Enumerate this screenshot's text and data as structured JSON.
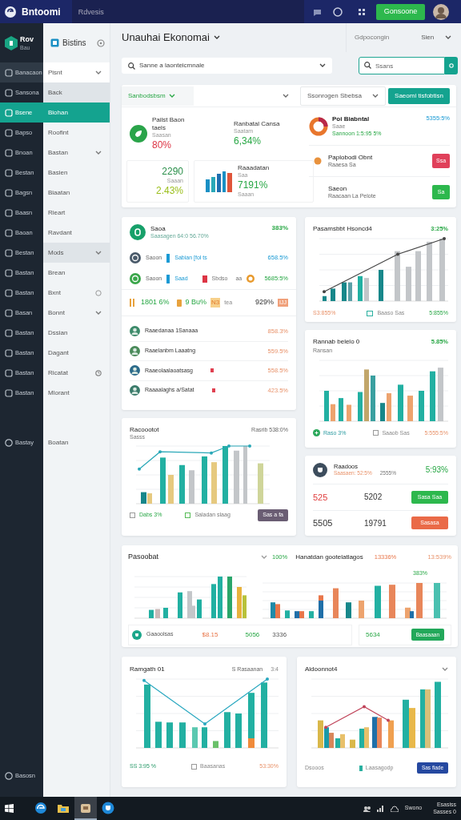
{
  "top_bar": {
    "logo": "Bntoomi",
    "search": "Rdvesis",
    "button": "Gonsoone"
  },
  "rail": {
    "title": "Rov",
    "subtitle": "Bau",
    "items": [
      {
        "label": "Banacaon",
        "selected": false
      },
      {
        "label": "Sansona",
        "selected": false
      },
      {
        "label": "Bsene",
        "selected": true
      },
      {
        "label": "Bapso",
        "selected": false
      },
      {
        "label": "Bnoan",
        "selected": false
      },
      {
        "label": "Bestan",
        "selected": false
      },
      {
        "label": "Bagsn",
        "selected": false
      },
      {
        "label": "Baasn",
        "selected": false
      },
      {
        "label": "Baoan",
        "selected": false
      },
      {
        "label": "Bestan",
        "selected": false
      },
      {
        "label": "Bastan",
        "selected": false
      },
      {
        "label": "Bastan",
        "selected": false
      },
      {
        "label": "Basan",
        "selected": false
      },
      {
        "label": "Bastan",
        "selected": false
      },
      {
        "label": "Bastan",
        "selected": false
      },
      {
        "label": "Bastan",
        "selected": false
      },
      {
        "label": "Bastan",
        "selected": false
      }
    ],
    "lower_item": "Bastay",
    "footer": "Basosn"
  },
  "panel": {
    "title": "Bistins",
    "items": [
      {
        "label": "Pisnt",
        "selected": false,
        "kind": "raised",
        "expandable": true
      },
      {
        "label": "Back",
        "selected": false,
        "kind": "shaded"
      },
      {
        "label": "Biohan",
        "selected": true
      },
      {
        "label": "Roofint",
        "selected": false
      },
      {
        "label": "Bastan",
        "selected": false,
        "expandable": true
      },
      {
        "label": "Basien",
        "selected": false
      },
      {
        "label": "Biaatan",
        "selected": false
      },
      {
        "label": "Rieart",
        "selected": false
      },
      {
        "label": "Ravdant",
        "selected": false
      },
      {
        "label": "Mods",
        "selected": false,
        "kind": "shaded",
        "expandable": true
      },
      {
        "label": "Brean",
        "selected": false
      },
      {
        "label": "Bxnt",
        "selected": false,
        "info": true
      },
      {
        "label": "Bonnt",
        "selected": false,
        "expandable": true
      },
      {
        "label": "Dssian",
        "selected": false
      },
      {
        "label": "Dagant",
        "selected": false
      },
      {
        "label": "Ricatat",
        "selected": false,
        "timer": true
      },
      {
        "label": "Mlorant",
        "selected": false
      }
    ],
    "lower_item": "Boatan"
  },
  "header": {
    "title": "Unauhai Ekonomai",
    "right_link": "Gdpocongin",
    "right_select": "Sien"
  },
  "filter": {
    "value": "Sanne a laonteicmnale",
    "search_placeholder": "Ssans"
  },
  "overview": {
    "dropdowns": [
      {
        "kind": "accent",
        "label": "Sanbodsbsm"
      },
      {
        "kind": "blank"
      },
      {
        "kind": "outlined",
        "label": "Ssonrogen Sbebsa"
      }
    ],
    "action": "Saeomi tisfobtisn",
    "stats": [
      {
        "title": "Pailst Baon taels",
        "sub": "Saasan",
        "value": "80%",
        "color": "#dc3545"
      },
      {
        "title": "Ranbatal Cansa",
        "sub": "Saatam",
        "value": "6,34%",
        "color": "#28a745"
      },
      {
        "title": "2290",
        "sub": "Saaan",
        "value": "2.43%",
        "color": "#9bbf1c"
      },
      {
        "title": "Raaadatan",
        "sub": "Saa",
        "value": "7191%",
        "color": "#28a745",
        "sub2": "Saaan"
      }
    ],
    "summary": {
      "title": "Poi Biabntal",
      "sub": "Saae",
      "line": "Sannoon 1:5:95 5%",
      "value": "5355:5%"
    },
    "actions": [
      {
        "title": "Paplobodi Obnt",
        "sub": "Raaesa Sa",
        "button": "Ssa",
        "color": "#e0405a"
      },
      {
        "title": "Saeon",
        "sub": "Raacaan La Pelote",
        "button": "Sa",
        "color": "#2db84d"
      }
    ]
  },
  "list_card": {
    "title": "Saoa",
    "sub": "Saasagen 64:0 56.70%",
    "value": "383%",
    "rows": [
      {
        "name": "Saoon",
        "tag": "Sabian [fol ts",
        "value": "658.5%"
      },
      {
        "name": "Saoon",
        "tag": "Saad",
        "tag2": "Sbdso",
        "tag3": "aa",
        "value": "5685:5%"
      }
    ],
    "stats": [
      "1801 6%",
      "9 Bu%",
      "N3",
      "tea",
      "929%",
      "IJJ"
    ],
    "items": [
      {
        "name": "Raaedanaa 1Sanaaa",
        "value": "858.3%",
        "flag": false
      },
      {
        "name": "Raaelanbm Laaatng",
        "value": "559.5%",
        "flag": false
      },
      {
        "name": "Raaeolaalaoatsasg",
        "value": "558.5%",
        "flag": true
      },
      {
        "name": "Raaaalaghs a/Satat",
        "value": "423.5%",
        "flag": true
      }
    ]
  },
  "trend_card": {
    "title": "Pasamsbbt Hsoncd4",
    "value": "3:25%",
    "footer_left": "S3:855%",
    "legend": "Baaso Sas",
    "footer_right": "5:855%"
  },
  "bars_card": {
    "title": "Rannab belelo 0",
    "value": "5.85%",
    "sub": "Ransan",
    "legend1": "Raso 3%",
    "legend2": "Saaob Sas",
    "footer_right": "5:555:5%"
  },
  "combo_card": {
    "title": "Racoootot",
    "sub": "Sasss",
    "right": "Rasrib 538:0%",
    "legend1": "Dabs 3%",
    "legend2": "Saladan slaag",
    "button": "Sas a fa"
  },
  "money_card": {
    "title": "Raadoos",
    "sub": "Saasaen: 52:5%",
    "sub2": "2555%",
    "value": "5:93%",
    "rows": [
      {
        "a": "525",
        "b": "5202",
        "button": "Sasa Saa",
        "kind": "good"
      },
      {
        "a": "5505",
        "b": "19791",
        "button": "Sasasa",
        "kind": "bad"
      }
    ]
  },
  "wide_card": {
    "title": "Pasoobat",
    "value1": "100%",
    "title2": "Hanatdan gootelatlagos",
    "value2": "13336%",
    "value3": "13:539%",
    "peak": "383%",
    "footer": [
      "Gaaoolsas",
      "$8.15",
      "5056",
      "3336",
      "5634"
    ],
    "button": "Baasaaan"
  },
  "report_card": {
    "title": "Ramgath 01",
    "link": "S Rasaanan",
    "more": "3:4",
    "footer_left": "SS 3:95 %",
    "legend": "Baasanas",
    "footer_right": "53:30%"
  },
  "last_card": {
    "title": "Aldoonnot4",
    "footer_left": "Dsooos",
    "legend": "Laasagodp",
    "button": "Sas fiade"
  },
  "taskbar": {
    "apps": [
      {
        "kind": "edge",
        "active": false
      },
      {
        "kind": "folder",
        "active": false
      },
      {
        "kind": "box",
        "active": true
      },
      {
        "kind": "shield",
        "active": false
      }
    ],
    "tray": "Swono",
    "clock": "Esasiss",
    "date": "Sasses 0"
  }
}
